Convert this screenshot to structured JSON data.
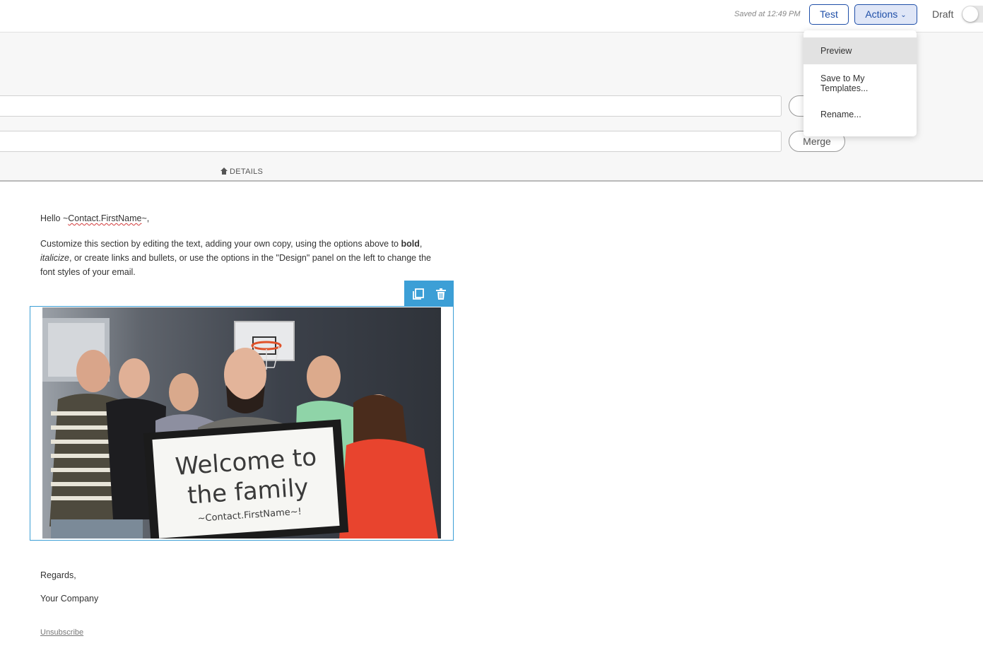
{
  "topbar": {
    "saved_text": "Saved at 12:49 PM",
    "test_label": "Test",
    "actions_label": "Actions",
    "draft_label": "Draft",
    "draft_enabled": false
  },
  "details": {
    "merge_label": "Merge",
    "toggle_label": "DETAILS"
  },
  "dropdown": {
    "items": [
      {
        "label": "Preview",
        "highlighted": true
      },
      {
        "label": "Save to My Templates...",
        "highlighted": false
      },
      {
        "label": "Rename...",
        "highlighted": false
      }
    ]
  },
  "email": {
    "greeting_prefix": "Hello ~",
    "greeting_merge": "Contact.FirstName",
    "greeting_suffix": "~,",
    "body_part1": "Customize this section by editing the text, adding your own copy, using the options above to ",
    "body_bold": "bold",
    "body_part2": ", ",
    "body_italic": "italicize",
    "body_part3": ", or create links and bullets, or use the options in the \"Design\" panel on the left to change the font styles of your email.",
    "sign_text_line1": "Welcome to",
    "sign_text_line2": "the family",
    "sign_text_line3": "~Contact.FirstName~!",
    "regards": "Regards,",
    "company": "Your Company",
    "unsubscribe": "Unsubscribe"
  },
  "icons": {
    "duplicate": "copy-icon",
    "delete": "trash-icon",
    "details_arrow": "house-up-icon"
  },
  "colors": {
    "accent": "#1f4fa8",
    "block_selected": "#3c9fd6",
    "spellcheck": "#d23a3a"
  }
}
